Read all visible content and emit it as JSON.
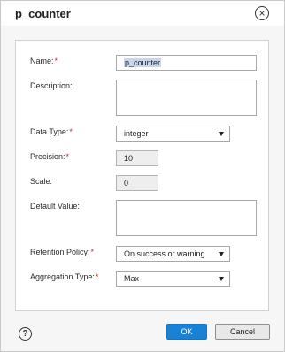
{
  "dialog": {
    "title": "p_counter",
    "close_glyph": "×",
    "help_glyph": "?"
  },
  "form": {
    "name_label": "Name:",
    "name_value": "p_counter",
    "description_label": "Description:",
    "description_value": "",
    "data_type_label": "Data Type:",
    "data_type_value": "integer",
    "precision_label": "Precision:",
    "precision_value": "10",
    "scale_label": "Scale:",
    "scale_value": "0",
    "default_value_label": "Default Value:",
    "default_value_value": "",
    "retention_policy_label": "Retention Policy:",
    "retention_policy_value": "On success or warning",
    "aggregation_type_label": "Aggregation Type:",
    "aggregation_type_value": "Max",
    "required_marker": "*"
  },
  "buttons": {
    "ok_label": "OK",
    "cancel_label": "Cancel"
  },
  "icons": {
    "close": "close-icon",
    "help": "help-icon",
    "dropdown": "chevron-down-icon"
  },
  "colors": {
    "primary_button": "#1a82d4",
    "required_marker": "#c62828"
  }
}
